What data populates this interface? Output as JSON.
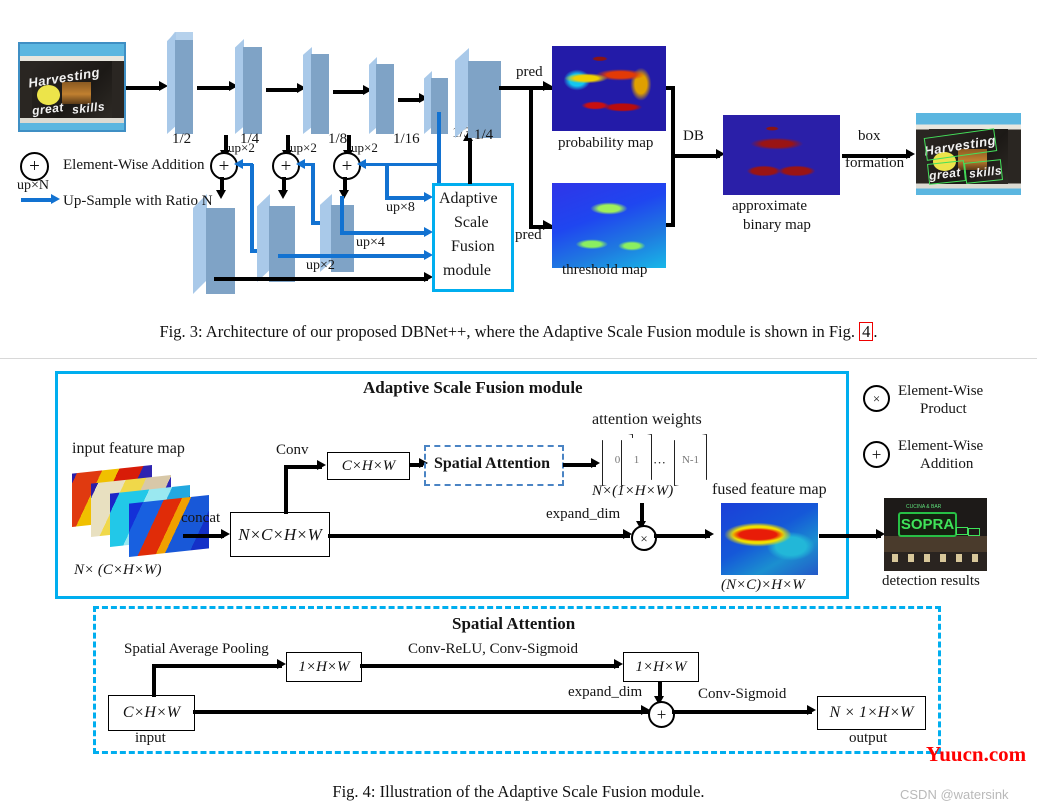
{
  "figure3": {
    "caption": "Fig. 3: Architecture of our proposed DBNet++, where the Adaptive Scale Fusion module is shown in Fig. ",
    "caption_ref": "4",
    "caption_tail": ".",
    "input_image_alt": "Harvesting great skills",
    "input_image_words": [
      "Harvesting",
      "great",
      "skills"
    ],
    "encoder_scales": [
      "1/2",
      "1/4",
      "1/8",
      "1/16",
      "1/32"
    ],
    "upsample_small": [
      "up×2",
      "up×2",
      "up×2"
    ],
    "fusion_upsamples": [
      "up×8",
      "up×4",
      "up×2"
    ],
    "asf_scale": "1/4",
    "asf_module_lines": [
      "Adaptive",
      "Scale",
      "Fusion",
      "module"
    ],
    "pred_labels": [
      "pred",
      "pred"
    ],
    "map_labels": {
      "probability": "probability map",
      "threshold": "threshold map",
      "binary_line1": "approximate",
      "binary_line2": "binary map"
    },
    "db_label": "DB",
    "box_formation_line1": "box",
    "box_formation_line2": "formation",
    "result_words": [
      "Harvesting",
      "great",
      "skills"
    ],
    "legend": {
      "plus_symbol": "+",
      "plus_text": "Element-Wise Addition",
      "up_symbol": "up×N",
      "up_text": "Up-Sample with Ratio N"
    }
  },
  "figure4": {
    "caption": "Fig. 4: Illustration of the Adaptive Scale Fusion module.",
    "asf": {
      "title": "Adaptive Scale Fusion module",
      "input_feature_map_label": "input feature map",
      "input_feature_map_dims": "N× (C×H×W)",
      "concat_label": "concat",
      "concat_box": "N×C×H×W",
      "conv_label": "Conv",
      "conv_box": "C×H×W",
      "spatial_attention_box": "Spatial Attention",
      "attention_weights_label": "attention weights",
      "attention_weights_dims": "N×(1×H×W)",
      "attention_cards": [
        "0",
        "1",
        "···",
        "N-1"
      ],
      "expand_dim_label": "expand_dim",
      "product_symbol": "×",
      "fused_feature_map_label": "fused feature map",
      "fused_feature_map_dims": "(N×C)×H×W",
      "detection_results_label": "detection results",
      "detection_sign_text": "SOPRA",
      "detection_sign_top": "CUCINA & BAR"
    },
    "legend": {
      "product_symbol": "×",
      "product_line1": "Element-Wise",
      "product_line2": "Product",
      "addition_symbol": "+",
      "addition_line1": "Element-Wise",
      "addition_line2": "Addition"
    },
    "spatial_attention": {
      "title": "Spatial Attention",
      "pooling_label": "Spatial Average Pooling",
      "input_box": "C×H×W",
      "input_label": "input",
      "pooled_box": "1×H×W",
      "conv_relu_label": "Conv-ReLU, Conv-Sigmoid",
      "mid_box": "1×H×W",
      "expand_dim_label": "expand_dim",
      "addition_symbol": "+",
      "conv_sigmoid_label": "Conv-Sigmoid",
      "output_box": "N × 1×H×W",
      "output_label": "output"
    }
  },
  "watermarks": {
    "red": "Yuucn.com",
    "gray": "CSDN @watersink"
  },
  "colors": {
    "cyan": "#00aeef",
    "blue_arrow": "#1272d1",
    "slab_front": "#7fa3c6",
    "slab_side": "#a9c9e9",
    "red_ref": "#ee0000"
  }
}
